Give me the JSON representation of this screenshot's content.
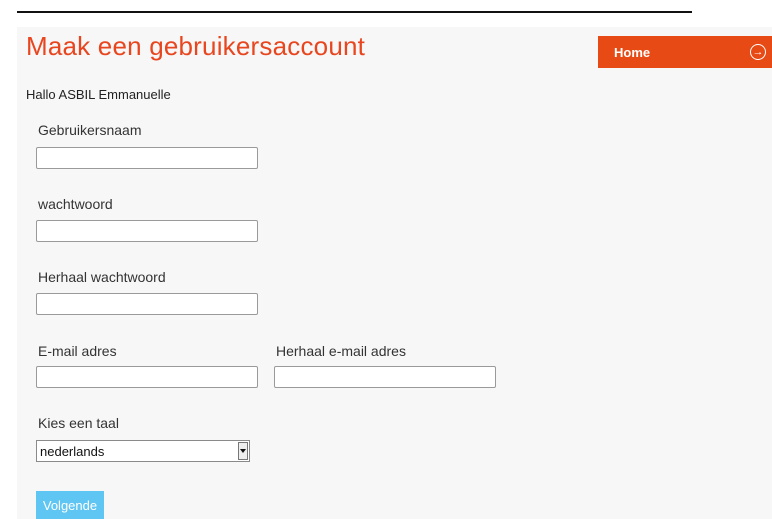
{
  "page": {
    "title": "Maak een gebruikersaccount",
    "greeting": "Hallo ASBIL Emmanuelle"
  },
  "nav": {
    "home_label": "Home",
    "home_icon": "arrow-right-circle-icon"
  },
  "form": {
    "username": {
      "label": "Gebruikersnaam",
      "value": ""
    },
    "password": {
      "label": "wachtwoord",
      "value": ""
    },
    "password_repeat": {
      "label": "Herhaal wachtwoord",
      "value": ""
    },
    "email": {
      "label": "E-mail adres",
      "value": ""
    },
    "email_repeat": {
      "label": "Herhaal e-mail adres",
      "value": ""
    },
    "language": {
      "label": "Kies een taal",
      "selected": "nederlands"
    },
    "submit_label": "Volgende"
  },
  "colors": {
    "accent": "#e84a15",
    "title": "#e8461f",
    "button": "#5fc5f2"
  }
}
